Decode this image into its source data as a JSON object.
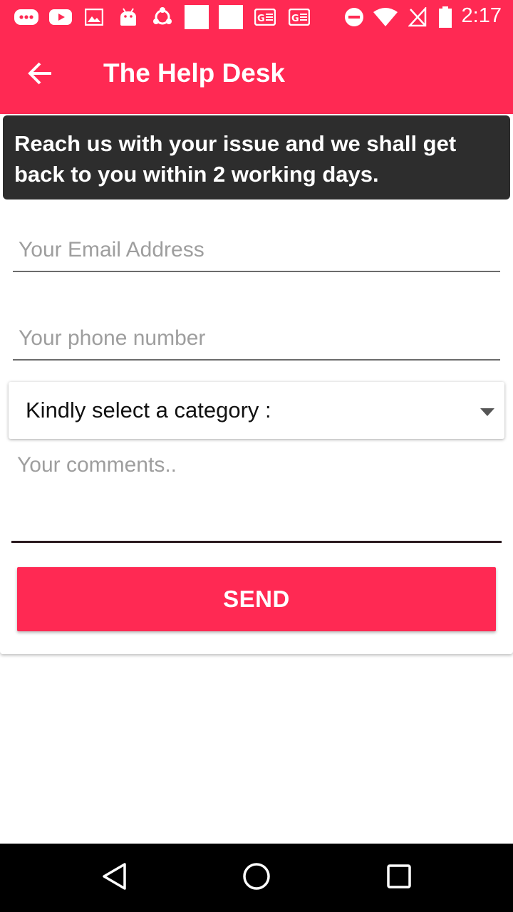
{
  "status_bar": {
    "time": "2:17",
    "left_icons": [
      "chat-bubble-icon",
      "youtube-icon",
      "image-icon",
      "android-icon",
      "sync-icon",
      "blank-notification-icon",
      "blank-notification-icon",
      "news-icon",
      "news-icon"
    ],
    "right_icons": [
      "do-not-disturb-icon",
      "wifi-icon",
      "no-signal-icon",
      "battery-icon"
    ]
  },
  "app_bar": {
    "title": "The Help Desk",
    "back_icon": "arrow-left-icon"
  },
  "banner": {
    "text": "Reach us with your issue and we shall get back to you within 2 working days."
  },
  "form": {
    "email_placeholder": "Your Email Address",
    "email_value": "",
    "phone_placeholder": "Your phone number",
    "phone_value": "",
    "category_label": "Kindly select a category :",
    "comments_placeholder": "Your comments..",
    "comments_value": "",
    "send_label": "SEND"
  },
  "nav_bar": {
    "icons": [
      "back-triangle-icon",
      "home-circle-icon",
      "recents-square-icon"
    ]
  },
  "colors": {
    "accent": "#ff2953",
    "banner_bg": "#2d2d2d",
    "nav_bg": "#000000"
  }
}
